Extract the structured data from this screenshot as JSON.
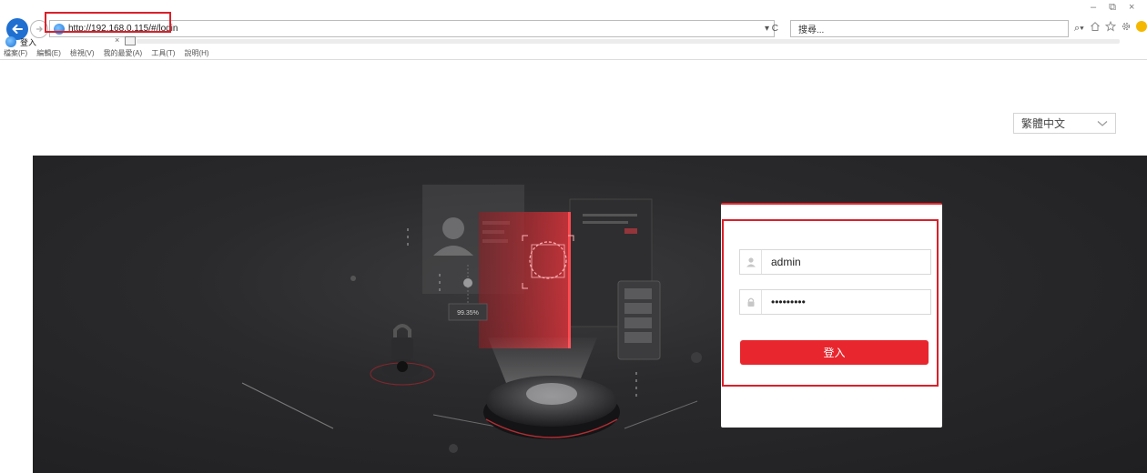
{
  "browser": {
    "address_url": "http://192.168.0.115/#/login",
    "refresh_glyph": "▾ C",
    "search_placeholder": "搜尋...",
    "search_glyph": "⌕▾",
    "tab_title": "登入",
    "tab_close": "×",
    "window_controls": [
      "–",
      "⧉",
      "×"
    ],
    "menu_items": [
      "檔案(F)",
      "編輯(E)",
      "檢視(V)",
      "我的最愛(A)",
      "工具(T)",
      "說明(H)"
    ],
    "icons": [
      "home-icon",
      "star-icon",
      "gear-icon",
      "smiley-icon"
    ],
    "accent": "#1f6fd1"
  },
  "language": {
    "selected": "繁體中文"
  },
  "login": {
    "username_value": "admin",
    "password_value": "•••••••••",
    "submit_label": "登入",
    "accent": "#e8262d"
  },
  "hero": {
    "match_score": "99.35%"
  }
}
